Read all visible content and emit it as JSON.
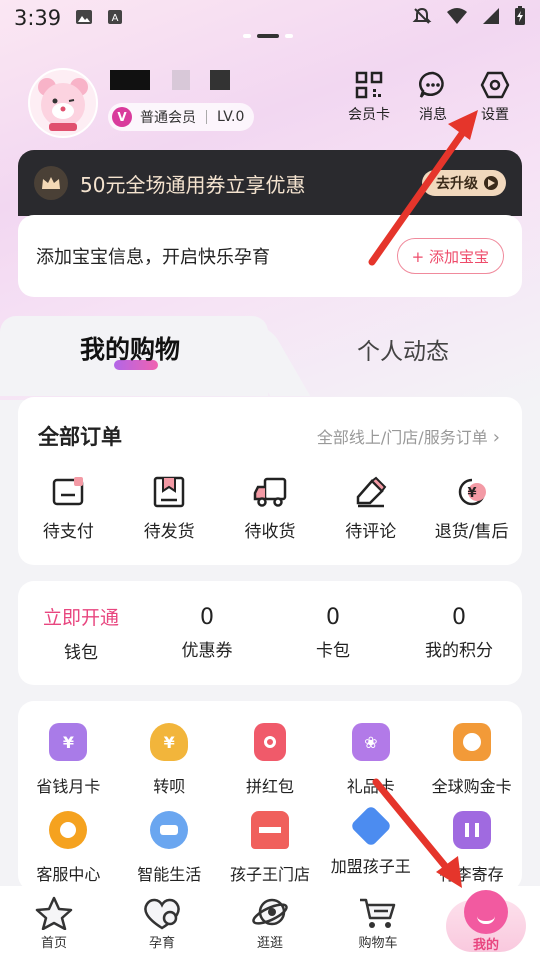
{
  "status_bar": {
    "time": "3:39"
  },
  "profile": {
    "member_level": "普通会员",
    "level_badge": "V",
    "lv": "LV.0"
  },
  "top_actions": [
    {
      "label": "会员卡",
      "icon": "qr-code-icon"
    },
    {
      "label": "消息",
      "icon": "chat-bubble-icon"
    },
    {
      "label": "设置",
      "icon": "settings-hexagon-icon"
    }
  ],
  "coupon_banner": {
    "text": "50元全场通用券立享优惠",
    "button": "去升级"
  },
  "baby_info": {
    "text": "添加宝宝信息，开启快乐孕育",
    "button": "+ 添加宝宝"
  },
  "tabs": {
    "active": "我的购物",
    "inactive": "个人动态"
  },
  "orders": {
    "title": "全部订单",
    "more": "全部线上/门店/服务订单",
    "items": [
      "待支付",
      "待发货",
      "待收货",
      "待评论",
      "退货/售后"
    ]
  },
  "wallet": {
    "items": [
      {
        "value": "立即开通",
        "label": "钱包"
      },
      {
        "value": "0",
        "label": "优惠券"
      },
      {
        "value": "0",
        "label": "卡包"
      },
      {
        "value": "0",
        "label": "我的积分"
      }
    ]
  },
  "tools": {
    "items": [
      {
        "label": "省钱月卡",
        "icon": "money-card-icon",
        "color": "#a97be8"
      },
      {
        "label": "转呗",
        "icon": "money-bag-icon",
        "color": "#f2b53b"
      },
      {
        "label": "拼红包",
        "icon": "red-packet-icon",
        "color": "#f05a6a"
      },
      {
        "label": "礼品卡",
        "icon": "gift-card-icon",
        "color": "#b27ae8"
      },
      {
        "label": "全球购金卡",
        "icon": "globe-card-icon",
        "color": "#f29a38"
      },
      {
        "label": "客服中心",
        "icon": "headset-icon",
        "color": "#f5a21f"
      },
      {
        "label": "智能生活",
        "icon": "smart-device-icon",
        "color": "#6aa6f0"
      },
      {
        "label": "孩子王门店",
        "icon": "store-icon",
        "color": "#f0605c"
      },
      {
        "label": "加盟孩子王",
        "icon": "handshake-icon",
        "color": "#4c8cf0"
      },
      {
        "label": "行李寄存",
        "icon": "luggage-icon",
        "color": "#a06ae0"
      }
    ]
  },
  "bottom_nav": {
    "items": [
      "首页",
      "孕育",
      "逛逛",
      "购物车"
    ],
    "active": "我的"
  }
}
